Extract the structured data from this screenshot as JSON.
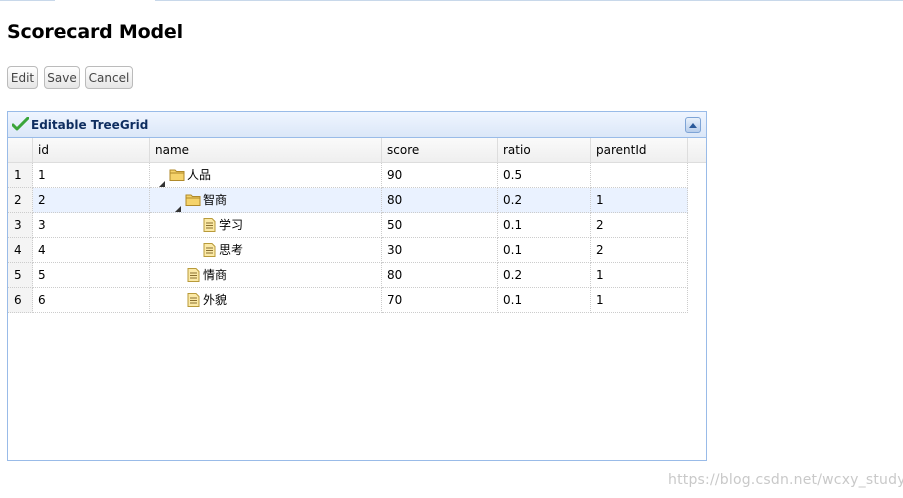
{
  "page": {
    "title": "Scorecard Model"
  },
  "toolbar": {
    "edit_label": "Edit",
    "save_label": "Save",
    "cancel_label": "Cancel"
  },
  "panel": {
    "title": "Editable TreeGrid",
    "title_icon": "checkmark-icon",
    "tool_icon": "collapse-icon"
  },
  "grid": {
    "columns": {
      "id": "id",
      "name": "name",
      "score": "score",
      "ratio": "ratio",
      "parentId": "parentId"
    },
    "rows": [
      {
        "rownum": "1",
        "id": "1",
        "name": "人品",
        "score": "90",
        "ratio": "0.5",
        "parentId": "",
        "level": 0,
        "type": "folder",
        "expanded": true
      },
      {
        "rownum": "2",
        "id": "2",
        "name": "智商",
        "score": "80",
        "ratio": "0.2",
        "parentId": "1",
        "level": 1,
        "type": "folder",
        "expanded": true,
        "selected": true
      },
      {
        "rownum": "3",
        "id": "3",
        "name": "学习",
        "score": "50",
        "ratio": "0.1",
        "parentId": "2",
        "level": 2,
        "type": "file"
      },
      {
        "rownum": "4",
        "id": "4",
        "name": "思考",
        "score": "30",
        "ratio": "0.1",
        "parentId": "2",
        "level": 2,
        "type": "file"
      },
      {
        "rownum": "5",
        "id": "5",
        "name": "情商",
        "score": "80",
        "ratio": "0.2",
        "parentId": "1",
        "level": 1,
        "type": "file"
      },
      {
        "rownum": "6",
        "id": "6",
        "name": "外貌",
        "score": "70",
        "ratio": "0.1",
        "parentId": "1",
        "level": 1,
        "type": "file"
      }
    ]
  },
  "watermark": "https://blog.csdn.net/wcxy_study",
  "colors": {
    "panel_border": "#99bbe8",
    "panel_title": "#0e2d5f",
    "selected_row": "#eaf2ff",
    "check_green": "#3aa53a",
    "folder_yellow": "#f5d36b",
    "file_yellow": "#fbe9a6"
  }
}
